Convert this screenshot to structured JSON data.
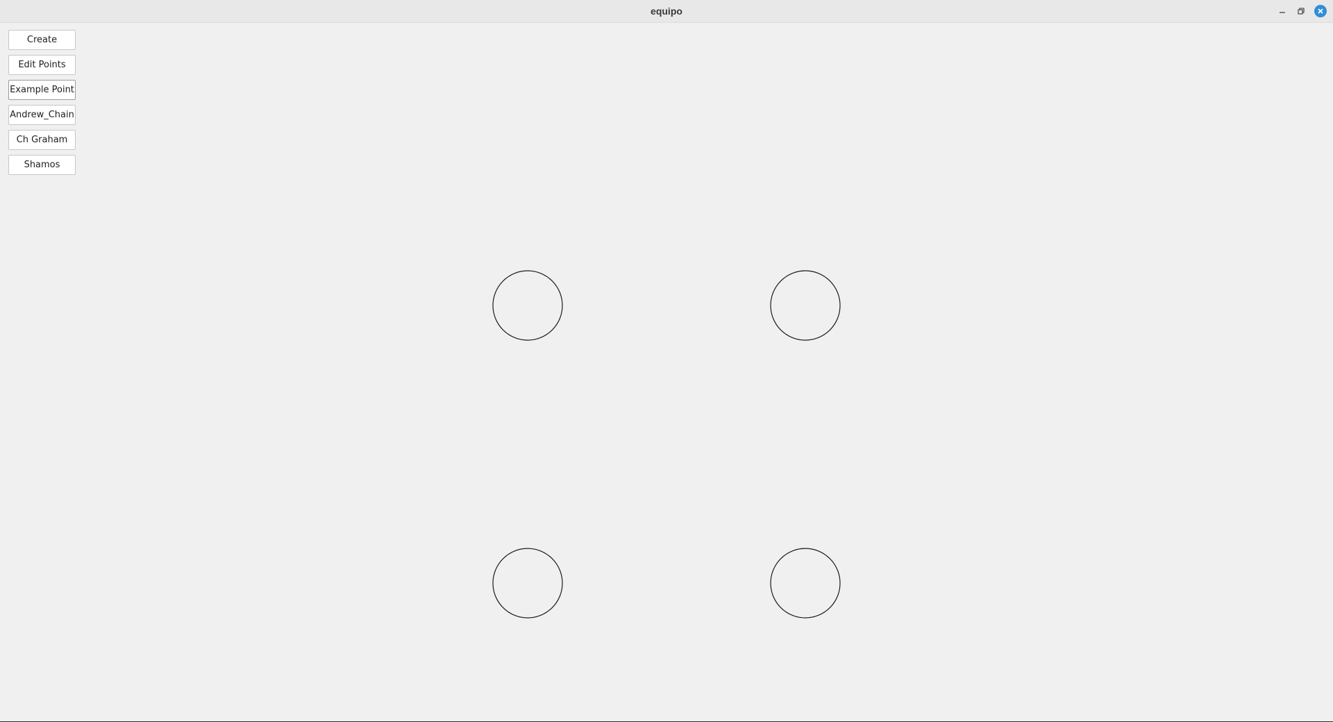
{
  "window": {
    "title": "equipo"
  },
  "titlebar_icons": {
    "minimize": "minimize-icon",
    "maximize": "restore-icon",
    "close": "close-icon",
    "close_color": "#2f8ed8"
  },
  "sidebar": {
    "buttons": [
      {
        "label": "Create"
      },
      {
        "label": "Edit Points"
      },
      {
        "label": "Example Point"
      },
      {
        "label": "Andrew_Chain"
      },
      {
        "label": "Ch Graham"
      },
      {
        "label": "Shamos"
      }
    ]
  },
  "canvas": {
    "point_count": 4
  }
}
